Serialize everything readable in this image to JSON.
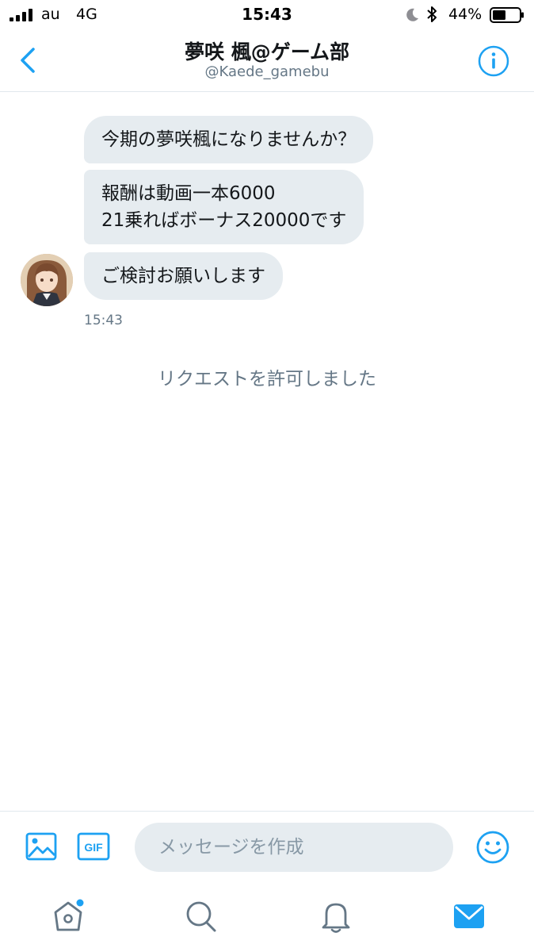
{
  "status_bar": {
    "carrier": "au",
    "network": "4G",
    "time": "15:43",
    "battery_pct": "44%"
  },
  "header": {
    "name": "夢咲 楓@ゲーム部",
    "handle": "@Kaede_gamebu"
  },
  "conversation": {
    "messages": [
      {
        "text": "今期の夢咲楓になりませんか？"
      },
      {
        "text": "報酬は動画一本6000\n21乗ればボーナス20000です"
      },
      {
        "text": "ご検討お願いします"
      }
    ],
    "timestamp": "15:43",
    "system_message": "リクエストを許可しました"
  },
  "compose": {
    "placeholder": "メッセージを作成",
    "gif_label": "GIF"
  },
  "tabbar": {
    "items": [
      "home-icon",
      "search-icon",
      "notifications-icon",
      "messages-icon"
    ],
    "home_has_badge": true
  },
  "colors": {
    "accent": "#1da1f2",
    "bubble_bg": "#e6ecf0",
    "muted_text": "#657786",
    "icon_gray": "#657786"
  }
}
